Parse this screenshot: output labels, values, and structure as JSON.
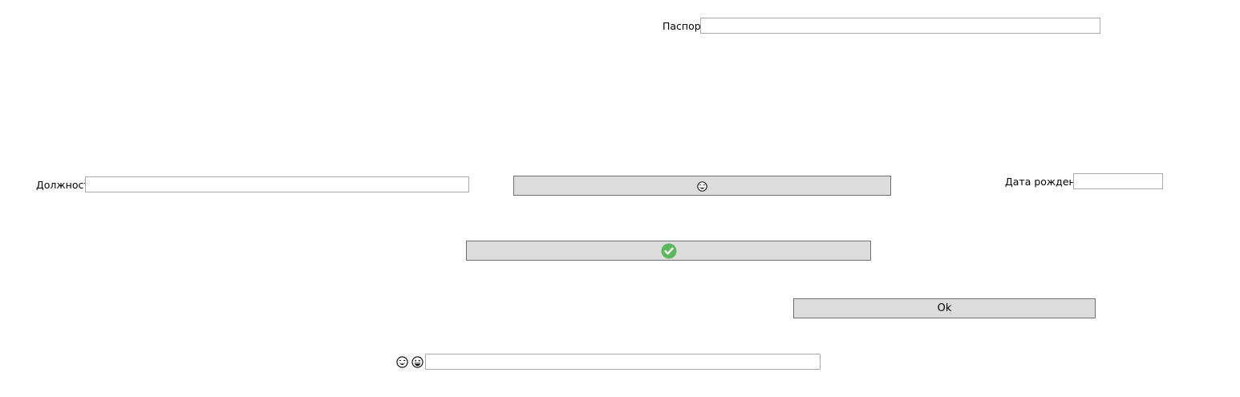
{
  "form": {
    "passport_label": "Паспорт",
    "passport_value": "",
    "position_label": "Должность",
    "position_value": "",
    "birthdate_label": "Дата рождения",
    "birthdate_value": "",
    "bottom_value": ""
  },
  "buttons": {
    "emoji_button_icon": "laughing-face-icon",
    "confirm_button_icon": "green-check-icon",
    "ok_label": "Ok"
  },
  "bottom_row": {
    "icons": [
      "laughing-face-icon",
      "grinning-face-icon"
    ]
  },
  "colors": {
    "button_bg": "#dddddd",
    "button_border": "#707070",
    "field_border": "#ababab",
    "check_green": "#5cb85c"
  }
}
